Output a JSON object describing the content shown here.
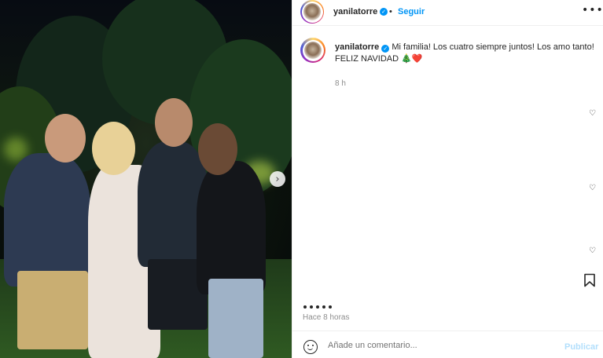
{
  "post": {
    "next_icon": "chevron-right-icon",
    "next_glyph": "›"
  },
  "header": {
    "username": "yanilatorre",
    "verified_glyph": "✓",
    "separator": "•",
    "follow_label": "Seguir",
    "more_glyph": "•••"
  },
  "caption": {
    "username": "yanilatorre",
    "verified_glyph": "✓",
    "text": "Mi familia! Los cuatro siempre juntos! Los amo tanto!",
    "line2": "FELIZ NAVIDAD 🎄❤️",
    "time": "8 h"
  },
  "likes": {
    "heart_glyph": "♡",
    "heart_icon": "heart-outline-icon"
  },
  "footer": {
    "posted_time": "Hace 8 horas",
    "comment_placeholder": "Añade un comentario...",
    "publish_label": "Publicar"
  },
  "colors": {
    "accent": "#0095f6",
    "text": "#262626",
    "muted": "#8e8e8e",
    "publish_disabled": "#b2dffc"
  }
}
